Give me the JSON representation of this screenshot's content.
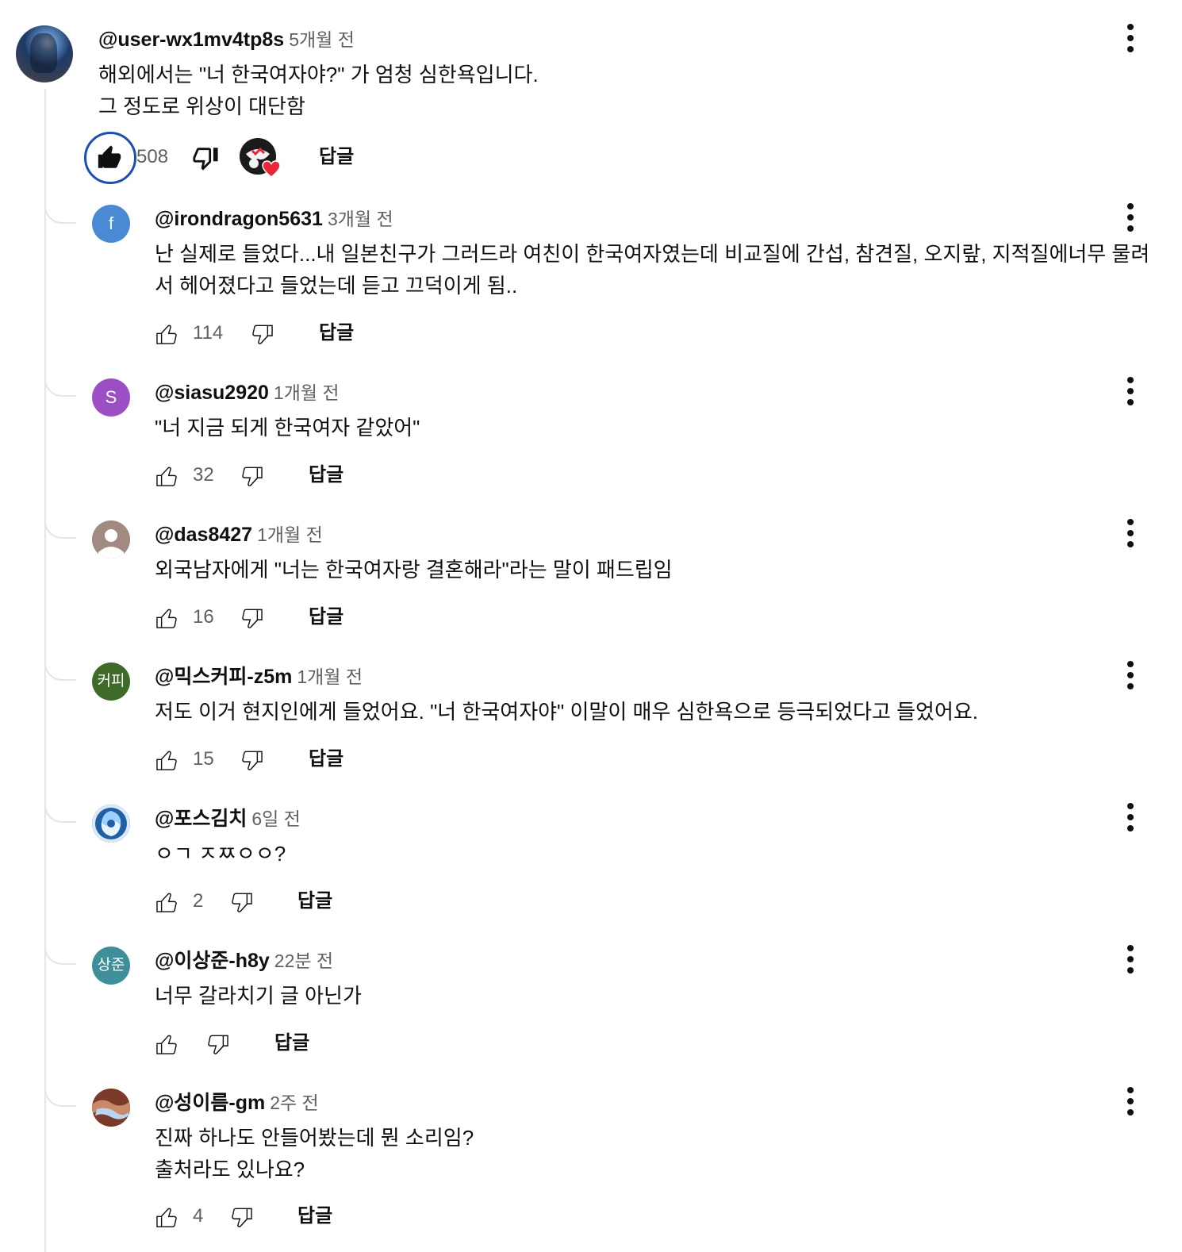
{
  "top_comment": {
    "handle": "@user-wx1mv4tp8s",
    "time": "5개월 전",
    "body": "해외에서는 \"너 한국여자야?\" 가 엄청 심한욕입니다.\n그 정도로 위상이 대단함",
    "likes": "508",
    "reply_label": "답글",
    "liked": true,
    "creator_heart": true
  },
  "replies": [
    {
      "handle": "@irondragon5631",
      "time": "3개월 전",
      "avatar_text": "f",
      "avatar_color": "#4a8ad4",
      "body": "난 실제로 들었다...내 일본친구가 그러드라 여친이 한국여자였는데 비교질에 간섭, 참견질, 오지랖, 지적질에너무 물려\n서 헤어졌다고 들었는데 듣고 끄덕이게 됨..",
      "likes": "114",
      "reply_label": "답글"
    },
    {
      "handle": "@siasu2920",
      "time": "1개월 전",
      "avatar_text": "S",
      "avatar_color": "#9c4fc4",
      "body": "\"너 지금 되게 한국여자 같았어\"",
      "likes": "32",
      "reply_label": "답글"
    },
    {
      "handle": "@das8427",
      "time": "1개월 전",
      "avatar_text": "",
      "avatar_color": "#a08a82",
      "body": "외국남자에게 \"너는 한국여자랑 결혼해라\"라는 말이 패드립임",
      "likes": "16",
      "reply_label": "답글"
    },
    {
      "handle": "@믹스커피-z5m",
      "time": "1개월 전",
      "avatar_text": "커피",
      "avatar_color": "#3f6b2a",
      "body": "저도 이거 현지인에게 들었어요. \"너 한국여자야\" 이말이 매우 심한욕으로 등극되었다고 들었어요.",
      "likes": "15",
      "reply_label": "답글"
    },
    {
      "handle": "@포스김치",
      "time": "6일 전",
      "avatar_text": "",
      "avatar_color": "#2a6fb0",
      "body": "ㅇㄱ ㅈㅉㅇㅇ?",
      "likes": "2",
      "reply_label": "답글"
    },
    {
      "handle": "@이상준-h8y",
      "time": "22분 전",
      "avatar_text": "상준",
      "avatar_color": "#3f8f9a",
      "body": "너무 갈라치기 글 아닌가",
      "likes": "",
      "reply_label": "답글"
    },
    {
      "handle": "@성이름-gm",
      "time": "2주 전",
      "avatar_text": "",
      "avatar_color": "#7a3a2a",
      "body": "진짜 하나도 안들어봤는데 뭔 소리임?\n출처라도 있나요?",
      "likes": "4",
      "reply_label": "답글"
    }
  ],
  "icons": {
    "like": "thumb-up-icon",
    "dislike": "thumb-down-icon",
    "more": "more-vert-icon",
    "heart": "creator-heart-icon"
  },
  "colors": {
    "liked_ring": "#1a4fb4",
    "heart": "#e8283a",
    "secondary_text": "#606060"
  }
}
